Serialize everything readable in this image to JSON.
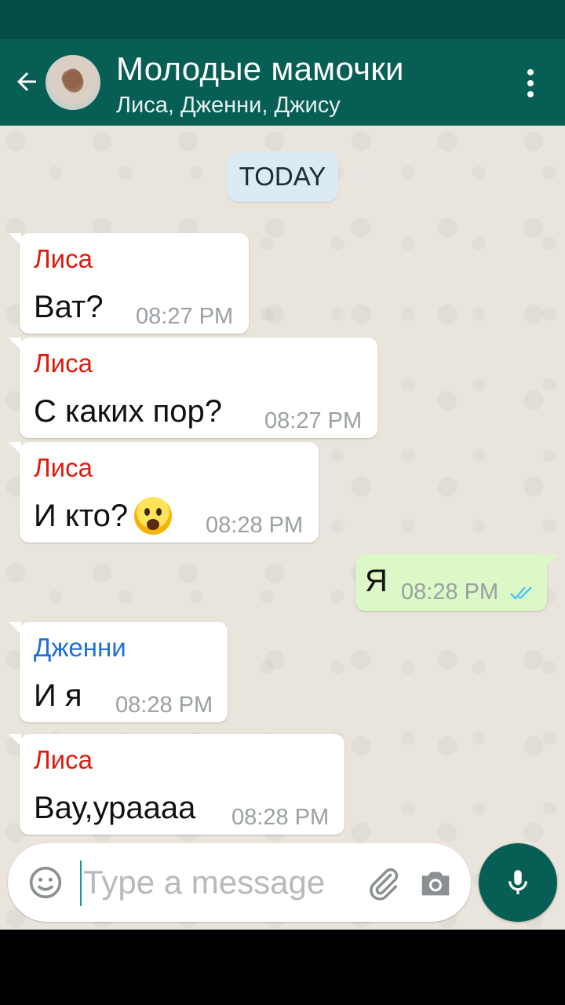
{
  "colors": {
    "header": "#075e54",
    "status_bar": "#054d44",
    "outgoing_bubble": "#dcf8c6",
    "date_chip": "#dbeaf3",
    "sender_lisa": "#e0190e",
    "sender_jenni": "#1f6fd6",
    "read_ticks": "#4fc3f7"
  },
  "header": {
    "back_icon": "arrow-left-icon",
    "title": "Молодые мамочки",
    "subtitle": "Лиса, Дженни, Джису",
    "menu_icon": "more-vert-icon"
  },
  "chat": {
    "date_label": "TODAY",
    "messages": [
      {
        "sender": "Лиса",
        "text": "Ват?",
        "time": "08:27 PM",
        "outgoing": false
      },
      {
        "sender": "Лиса",
        "text": "С каких пор?",
        "time": "08:27 PM",
        "outgoing": false
      },
      {
        "sender": "Лиса",
        "text": "И кто?",
        "emoji": "face-screaming-in-fear",
        "time": "08:28 PM",
        "outgoing": false
      },
      {
        "text": "Я",
        "time": "08:28 PM",
        "outgoing": true,
        "status": "read-double-check-icon"
      },
      {
        "sender": "Дженни",
        "text": "И я",
        "time": "08:28 PM",
        "outgoing": false
      },
      {
        "sender": "Лиса",
        "text": "Вау,ураааа",
        "time": "08:28 PM",
        "outgoing": false
      }
    ]
  },
  "composer": {
    "placeholder": "Type a message",
    "emoji_icon": "smiley-icon",
    "attach_icon": "paperclip-icon",
    "camera_icon": "camera-icon",
    "mic_icon": "microphone-icon"
  }
}
